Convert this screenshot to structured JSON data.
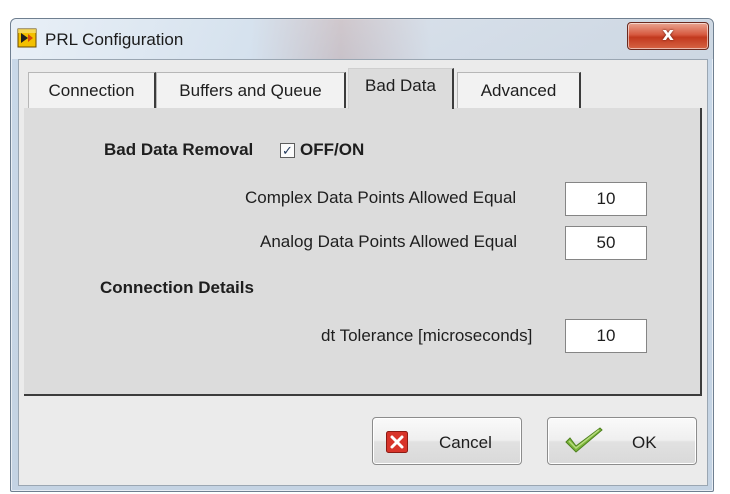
{
  "window": {
    "title": "PRL Configuration",
    "close_glyph": "x"
  },
  "tabs": [
    {
      "label": "Connection"
    },
    {
      "label": "Buffers and Queue"
    },
    {
      "label": "Bad Data",
      "active": true
    },
    {
      "label": "Advanced"
    }
  ],
  "bad_data": {
    "removal_label": "Bad Data Removal",
    "toggle_label": "OFF/ON",
    "toggle_checked": true,
    "check_glyph": "✓",
    "complex_label": "Complex Data Points Allowed Equal",
    "complex_value": "10",
    "analog_label": "Analog Data Points Allowed Equal",
    "analog_value": "50"
  },
  "connection_details": {
    "heading": "Connection Details",
    "dt_label": "dt Tolerance [microseconds]",
    "dt_value": "10"
  },
  "buttons": {
    "cancel_label": "Cancel",
    "ok_label": "OK"
  },
  "icons": {
    "app": "labview-app-icon",
    "close": "close-icon",
    "cancel": "red-x-icon",
    "ok": "green-check-icon"
  },
  "colors": {
    "cancel_icon": "#d8342a",
    "ok_icon": "#7bb53a",
    "close_button": "#c94a30"
  }
}
